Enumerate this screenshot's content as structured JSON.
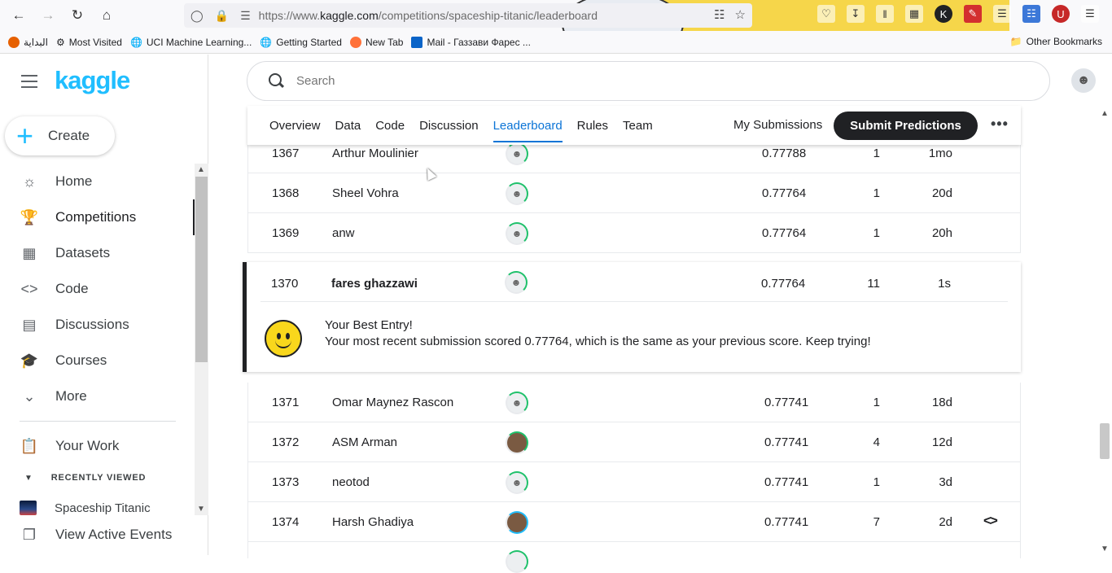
{
  "browser": {
    "url_prefix": "https://www.",
    "url_domain": "kaggle.com",
    "url_path": "/competitions/spaceship-titanic/leaderboard",
    "bookmarks": [
      "البداية",
      "Most Visited",
      "UCI Machine Learning...",
      "Getting Started",
      "New Tab",
      "Mail - Газзави Фарес ..."
    ],
    "other_bookmarks": "Other Bookmarks"
  },
  "sidebar": {
    "logo": "kaggle",
    "create_label": "Create",
    "nav": [
      "Home",
      "Competitions",
      "Datasets",
      "Code",
      "Discussions",
      "Courses",
      "More"
    ],
    "your_work": "Your Work",
    "recently_viewed": "RECENTLY VIEWED",
    "recent_item": "Spaceship Titanic",
    "view_active_events": "View Active Events"
  },
  "search": {
    "placeholder": "Search"
  },
  "tabs": {
    "items": [
      "Overview",
      "Data",
      "Code",
      "Discussion",
      "Leaderboard",
      "Rules",
      "Team"
    ],
    "active": "Leaderboard",
    "my_submissions": "My Submissions",
    "submit": "Submit Predictions"
  },
  "leaderboard": {
    "rows_before": [
      {
        "rank": "1367",
        "name": "Arthur Moulinier",
        "score": "0.77788",
        "entries": "1",
        "last": "1mo"
      },
      {
        "rank": "1368",
        "name": "Sheel Vohra",
        "score": "0.77764",
        "entries": "1",
        "last": "20d"
      },
      {
        "rank": "1369",
        "name": "anw",
        "score": "0.77764",
        "entries": "1",
        "last": "20h"
      }
    ],
    "current": {
      "rank": "1370",
      "name": "fares ghazzawi",
      "score": "0.77764",
      "entries": "11",
      "last": "1s"
    },
    "best_title": "Your Best Entry!",
    "best_message": "Your most recent submission scored 0.77764, which is the same as your previous score. Keep trying!",
    "rows_after": [
      {
        "rank": "1371",
        "name": "Omar Maynez Rascon",
        "score": "0.77741",
        "entries": "1",
        "last": "18d"
      },
      {
        "rank": "1372",
        "name": "ASM Arman",
        "score": "0.77741",
        "entries": "4",
        "last": "12d"
      },
      {
        "rank": "1373",
        "name": "neotod",
        "score": "0.77741",
        "entries": "1",
        "last": "3d"
      },
      {
        "rank": "1374",
        "name": "Harsh Ghadiya",
        "score": "0.77741",
        "entries": "7",
        "last": "2d"
      }
    ]
  },
  "colors": {
    "accent": "#20beff",
    "active_tab": "#0b74d6",
    "dark": "#202124",
    "progress_green": "#1fc16b"
  }
}
